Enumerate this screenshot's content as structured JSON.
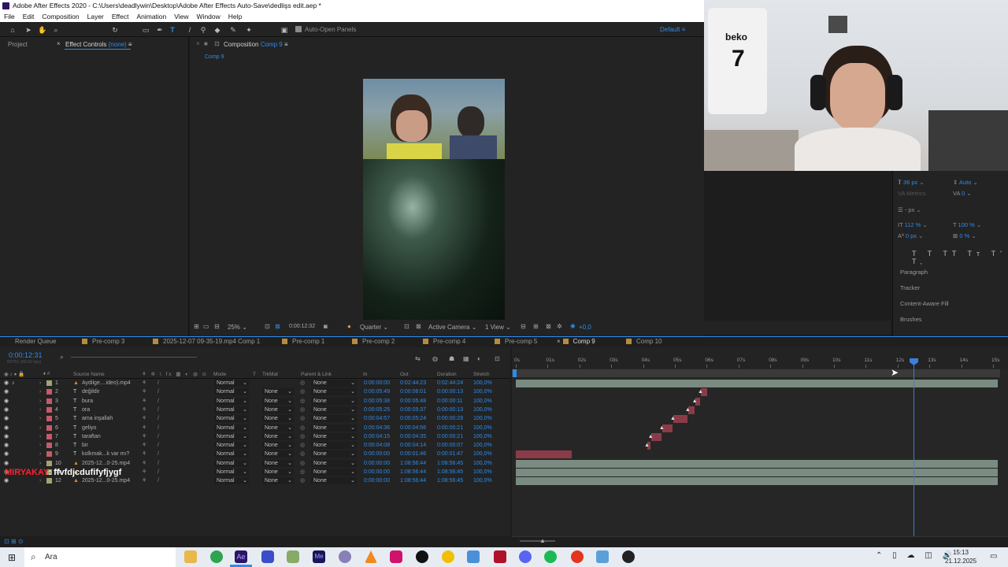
{
  "window": {
    "title": "Adobe After Effects 2020 - C:\\Users\\deadlywin\\Desktop\\Adobe After Effects Auto-Save\\dedlişs edit.aep *"
  },
  "menu": [
    "File",
    "Edit",
    "Composition",
    "Layer",
    "Effect",
    "Animation",
    "View",
    "Window",
    "Help"
  ],
  "toolbar": {
    "auto_open": "Auto-Open Panels",
    "workspace": "Default"
  },
  "left_panel": {
    "project_tab": "Project",
    "effect_tab": "Effect Controls",
    "effect_none": "(none)"
  },
  "comp_panel": {
    "tab": "Composition",
    "comp_name": "Comp 9",
    "sub_tab": "Comp 9"
  },
  "comp_bar": {
    "zoom": "25%",
    "timecode": "0:00:12:32",
    "resolution": "Quarter",
    "camera": "Active Camera",
    "views": "1 View",
    "exposure": "+0,0"
  },
  "right_panel": {
    "font_size": "36 px",
    "leading": "Auto",
    "kerning": "Metrics",
    "tracking": "0",
    "stroke": "- px",
    "vscale": "112 %",
    "hscale": "100 %",
    "baseline": "0 px",
    "tsume": "0 %",
    "sections": [
      "Paragraph",
      "Tracker",
      "Content-Aware Fill",
      "Brushes"
    ]
  },
  "timeline_tabs": [
    "Render Queue",
    "Pre-comp 3",
    "2025-12-07 09-35-19.mp4 Comp 1",
    "Pre-comp 1",
    "Pre-comp 2",
    "Pre-comp 4",
    "Pre-comp 5",
    "Comp 9",
    "Comp 10"
  ],
  "timeline": {
    "current_time": "0:00:12:31",
    "frame_info": "00751 (60.00 fps)",
    "col_source": "Source Name",
    "col_mode": "Mode",
    "col_t": "T",
    "col_trkmat": "TrkMat",
    "col_parent": "Parent & Link",
    "col_in": "In",
    "col_out": "Out",
    "col_duration": "Duration",
    "col_stretch": "Stretch",
    "ruler": [
      "0s",
      "01s",
      "02s",
      "03s",
      "04s",
      "05s",
      "06s",
      "07s",
      "08s",
      "09s",
      "10s",
      "11s",
      "12s",
      "13s",
      "14s",
      "15s"
    ],
    "layers": [
      {
        "num": "1",
        "type": "video",
        "name": "Aydilge....ideo).mp4",
        "mode": "Normal",
        "trkmat": "",
        "parent": "None",
        "in": "0:00:00:00",
        "out": "0:02:44:23",
        "duration": "0:02:44:24",
        "stretch": "100,0%",
        "color": "#a3a36f"
      },
      {
        "num": "2",
        "type": "T",
        "name": "değildir",
        "mode": "Normal",
        "trkmat": "None",
        "parent": "None",
        "in": "0:00:05:49",
        "out": "0:00:06:01",
        "duration": "0:00:00:13",
        "stretch": "100,0%",
        "color": "#c65a6a"
      },
      {
        "num": "3",
        "type": "T",
        "name": "bura",
        "mode": "Normal",
        "trkmat": "None",
        "parent": "None",
        "in": "0:00:05:38",
        "out": "0:00:05:48",
        "duration": "0:00:00:11",
        "stretch": "100,0%",
        "color": "#c65a6a"
      },
      {
        "num": "4",
        "type": "T",
        "name": "ora",
        "mode": "Normal",
        "trkmat": "None",
        "parent": "None",
        "in": "0:00:05:25",
        "out": "0:00:05:37",
        "duration": "0:00:00:13",
        "stretch": "100,0%",
        "color": "#c65a6a"
      },
      {
        "num": "5",
        "type": "T",
        "name": "ama inşallah",
        "mode": "Normal",
        "trkmat": "None",
        "parent": "None",
        "in": "0:00:04:57",
        "out": "0:00:05:24",
        "duration": "0:00:00:28",
        "stretch": "100,0%",
        "color": "#c65a6a"
      },
      {
        "num": "6",
        "type": "T",
        "name": "geliyo",
        "mode": "Normal",
        "trkmat": "None",
        "parent": "None",
        "in": "0:00:04:36",
        "out": "0:00:04:56",
        "duration": "0:00:00:21",
        "stretch": "100,0%",
        "color": "#c65a6a"
      },
      {
        "num": "7",
        "type": "T",
        "name": "taraftan",
        "mode": "Normal",
        "trkmat": "None",
        "parent": "None",
        "in": "0:00:04:15",
        "out": "0:00:04:35",
        "duration": "0:00:00:21",
        "stretch": "100,0%",
        "color": "#c65a6a"
      },
      {
        "num": "8",
        "type": "T",
        "name": "bir",
        "mode": "Normal",
        "trkmat": "None",
        "parent": "None",
        "in": "0:00:04:08",
        "out": "0:00:04:14",
        "duration": "0:00:00:07",
        "stretch": "100,0%",
        "color": "#c65a6a"
      },
      {
        "num": "9",
        "type": "T",
        "name": "kolkmak...k var mı?",
        "mode": "Normal",
        "trkmat": "None",
        "parent": "None",
        "in": "0:00:00:00",
        "out": "0:00:01:46",
        "duration": "0:00:01:47",
        "stretch": "100,0%",
        "color": "#c65a6a"
      },
      {
        "num": "10",
        "type": "video",
        "name": "2025-12...0-25.mp4",
        "mode": "Normal",
        "trkmat": "None",
        "parent": "None",
        "in": "0:00:00:00",
        "out": "1:08:56:44",
        "duration": "1:08:56:45",
        "stretch": "100,0%",
        "color": "#a3a36f"
      },
      {
        "num": "11",
        "type": "video",
        "name": "",
        "mode": "Normal",
        "trkmat": "None",
        "parent": "None",
        "in": "0:00:00:00",
        "out": "1:08:56:44",
        "duration": "1:08:56:45",
        "stretch": "100,0%",
        "color": "#a3a36f"
      },
      {
        "num": "12",
        "type": "video",
        "name": "2025-12...0-25.mp4",
        "mode": "Normal",
        "trkmat": "None",
        "parent": "None",
        "in": "0:00:00:00",
        "out": "1:08:56:44",
        "duration": "1:08:56:45",
        "stretch": "100,0%",
        "color": "#a3a36f"
      }
    ]
  },
  "overlay": {
    "red": "MIRYAKAY",
    "white": ": ffvfdjcdufifyfjygf"
  },
  "taskbar": {
    "search": "Ara",
    "time": "15:13",
    "date": "21.12.2025"
  }
}
